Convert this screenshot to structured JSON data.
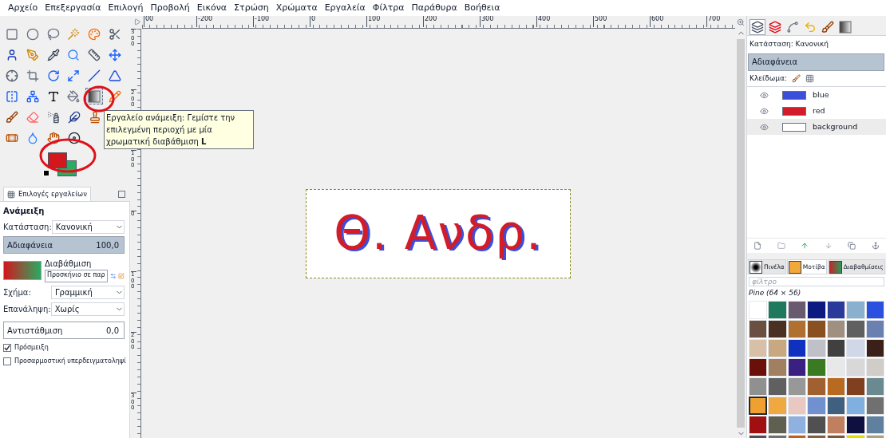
{
  "menu": [
    "Αρχείο",
    "Επεξεργασία",
    "Επιλογή",
    "Προβολή",
    "Εικόνα",
    "Στρώση",
    "Χρώματα",
    "Εργαλεία",
    "Φίλτρα",
    "Παράθυρα",
    "Βοήθεια"
  ],
  "toolbox": {
    "tool_rows": [
      [
        {
          "kind": "rect-select",
          "selected": false
        },
        {
          "kind": "ellipse-select",
          "selected": false
        },
        {
          "kind": "free-select",
          "selected": false
        },
        {
          "kind": "fuzzy-select",
          "selected": false
        },
        {
          "kind": "color-select",
          "selected": false
        },
        {
          "kind": "scissors-select",
          "selected": false
        }
      ],
      [
        {
          "kind": "foreground-select",
          "selected": false
        },
        {
          "kind": "paths",
          "selected": false
        },
        {
          "kind": "color-picker",
          "selected": false
        },
        {
          "kind": "zoom",
          "selected": false
        },
        {
          "kind": "measure",
          "selected": false
        },
        {
          "kind": "move",
          "selected": false
        }
      ],
      [
        {
          "kind": "align",
          "selected": false
        },
        {
          "kind": "crop",
          "selected": false
        },
        {
          "kind": "rotate",
          "selected": false
        },
        {
          "kind": "scale",
          "selected": false
        },
        {
          "kind": "shear",
          "selected": false
        },
        {
          "kind": "perspective",
          "selected": false
        }
      ],
      [
        {
          "kind": "flip",
          "selected": false
        },
        {
          "kind": "cage",
          "selected": false
        },
        {
          "kind": "text",
          "selected": false
        },
        {
          "kind": "bucket-fill",
          "selected": false
        },
        {
          "kind": "blend",
          "selected": true
        },
        {
          "kind": "pencil",
          "selected": false
        }
      ],
      [
        {
          "kind": "paintbrush",
          "selected": false
        },
        {
          "kind": "eraser",
          "selected": false
        },
        {
          "kind": "airbrush",
          "selected": false
        },
        {
          "kind": "ink",
          "selected": false
        },
        {
          "kind": "clone",
          "selected": false
        }
      ],
      [
        {
          "kind": "heal",
          "selected": false
        },
        {
          "kind": "blur",
          "selected": false
        },
        {
          "kind": "smudge",
          "selected": false
        },
        {
          "kind": "dodge",
          "selected": false
        }
      ]
    ],
    "color_swatches": [
      {
        "kind": "foreground",
        "color": "#d2171d"
      },
      {
        "kind": "background",
        "color": "#2aab62"
      }
    ]
  },
  "tooltip": {
    "text": "Εργαλείο ανάμειξη: Γεμίστε την επιλεγμένη περιοχή με μία χρωματική διαβάθμιση  **L**"
  },
  "tool_options": {
    "tab": "Επιλογές εργαλείων",
    "title": "Ανάμειξη",
    "mode": {
      "label": "Κατάσταση:",
      "value": "Κανονική"
    },
    "opacity": {
      "label": "Αδιαφάνεια",
      "reading": "100,0",
      "level": 1
    },
    "gradient": {
      "label": "Διαβάθμιση",
      "value": "Προσκήνιο σε παρ"
    },
    "shape": {
      "label": "Σχήμα:",
      "value": "Γραμμική"
    },
    "repeat": {
      "label": "Επανάληψη:",
      "value": "Χωρίς"
    },
    "offset": {
      "label": "Αντιστάθμιση",
      "reading": "0,0"
    },
    "checkboxes": [
      {
        "label": "Πρόσμειξη",
        "checked": true
      },
      {
        "label": "Προσαρμοστική υπερδειγματοληψί",
        "checked": false
      }
    ]
  },
  "rulers": {
    "horizontal": [
      "00",
      "-200",
      "-100",
      "0",
      "100",
      "200",
      "300",
      "400",
      "500",
      "600",
      "700"
    ],
    "vertical": [
      "300",
      "200",
      "100",
      "0",
      "100",
      "200",
      "300"
    ]
  },
  "canvas": {
    "text": "Θ. Ανδρ."
  },
  "layers_panel": {
    "dock_tabs": [
      {
        "kind": "layers",
        "selected": true
      },
      {
        "kind": "channels",
        "selected": false
      },
      {
        "kind": "paths",
        "selected": false
      },
      {
        "kind": "undo",
        "selected": false
      },
      {
        "kind": "brush",
        "selected": false
      },
      {
        "kind": "gradient",
        "selected": false
      }
    ],
    "mode": "Κατάσταση: Κανονική",
    "opacity": {
      "label": "Αδιαφάνεια",
      "level": 1
    },
    "lock_label": "Κλείδωμα:",
    "layers": [
      {
        "name": "blue",
        "color": "#3b4fd8",
        "visible": true,
        "selected": false
      },
      {
        "name": "red",
        "color": "#d21c2a",
        "visible": true,
        "selected": false
      },
      {
        "name": "background",
        "color": "#ffffff",
        "visible": true,
        "selected": true
      }
    ]
  },
  "resources_panel": {
    "tabs": [
      {
        "label": "Πινέλα",
        "kind": "brushes",
        "selected": false
      },
      {
        "label": "Μοτίβα",
        "kind": "patterns",
        "selected": true
      },
      {
        "label": "Διαβαθμίσεις",
        "kind": "gradients",
        "selected": false
      }
    ],
    "filter_placeholder": "φίλτρο",
    "pattern_name": "Pine (64 × 56)",
    "patterns": [
      {
        "color": "#ffffff",
        "selected": false
      },
      {
        "color": "#1f7a5c",
        "selected": false
      },
      {
        "color": "#6a5a70",
        "selected": false
      },
      {
        "color": "#0a1a80",
        "selected": false
      },
      {
        "color": "#2a3a9a",
        "selected": false
      },
      {
        "color": "#8ab0d0",
        "selected": false
      },
      {
        "color": "#2a50e0",
        "selected": false
      },
      {
        "color": "#6a5040",
        "selected": false
      },
      {
        "color": "#4a3020",
        "selected": false
      },
      {
        "color": "#b07030",
        "selected": false
      },
      {
        "color": "#8a5020",
        "selected": false
      },
      {
        "color": "#a09080",
        "selected": false
      },
      {
        "color": "#606060",
        "selected": false
      },
      {
        "color": "#6a80b0",
        "selected": false
      },
      {
        "color": "#d8c0a8",
        "selected": false
      },
      {
        "color": "#c8a880",
        "selected": false
      },
      {
        "color": "#1030c0",
        "selected": false
      },
      {
        "color": "#c0c0c8",
        "selected": false
      },
      {
        "color": "#404040",
        "selected": false
      },
      {
        "color": "#d0d8e8",
        "selected": false
      },
      {
        "color": "#3a2018",
        "selected": false
      },
      {
        "color": "#6a1008",
        "selected": false
      },
      {
        "color": "#a08060",
        "selected": false
      },
      {
        "color": "#3a2080",
        "selected": false
      },
      {
        "color": "#3a7a20",
        "selected": false
      },
      {
        "color": "#e8e8e8",
        "selected": false
      },
      {
        "color": "#d8d8d8",
        "selected": false
      },
      {
        "color": "#d0ccc8",
        "selected": false
      },
      {
        "color": "#909090",
        "selected": false
      },
      {
        "color": "#606060",
        "selected": false
      },
      {
        "color": "#989898",
        "selected": false
      },
      {
        "color": "#a06030",
        "selected": false
      },
      {
        "color": "#b86a20",
        "selected": false
      },
      {
        "color": "#804020",
        "selected": false
      },
      {
        "color": "#6a8a90",
        "selected": false
      },
      {
        "color": "#f0a030",
        "selected": true
      },
      {
        "color": "#f0a840",
        "selected": false
      },
      {
        "color": "#e8c8c0",
        "selected": false
      },
      {
        "color": "#7090d0",
        "selected": false
      },
      {
        "color": "#406080",
        "selected": false
      },
      {
        "color": "#80b0e0",
        "selected": false
      },
      {
        "color": "#707070",
        "selected": false
      },
      {
        "color": "#a01010",
        "selected": false
      },
      {
        "color": "#606050",
        "selected": false
      },
      {
        "color": "#90b0e0",
        "selected": false
      },
      {
        "color": "#505050",
        "selected": false
      },
      {
        "color": "#c08060",
        "selected": false
      },
      {
        "color": "#101040",
        "selected": false
      },
      {
        "color": "#6080a0",
        "selected": false
      },
      {
        "color": "#505050",
        "selected": false
      },
      {
        "color": "#707070",
        "selected": false
      },
      {
        "color": "#c06020",
        "selected": false
      },
      {
        "color": "#806040",
        "selected": false
      },
      {
        "color": "#7a5838",
        "selected": false
      },
      {
        "color": "#e0e000",
        "selected": false
      },
      {
        "color": "#b0a080",
        "selected": false
      }
    ]
  }
}
